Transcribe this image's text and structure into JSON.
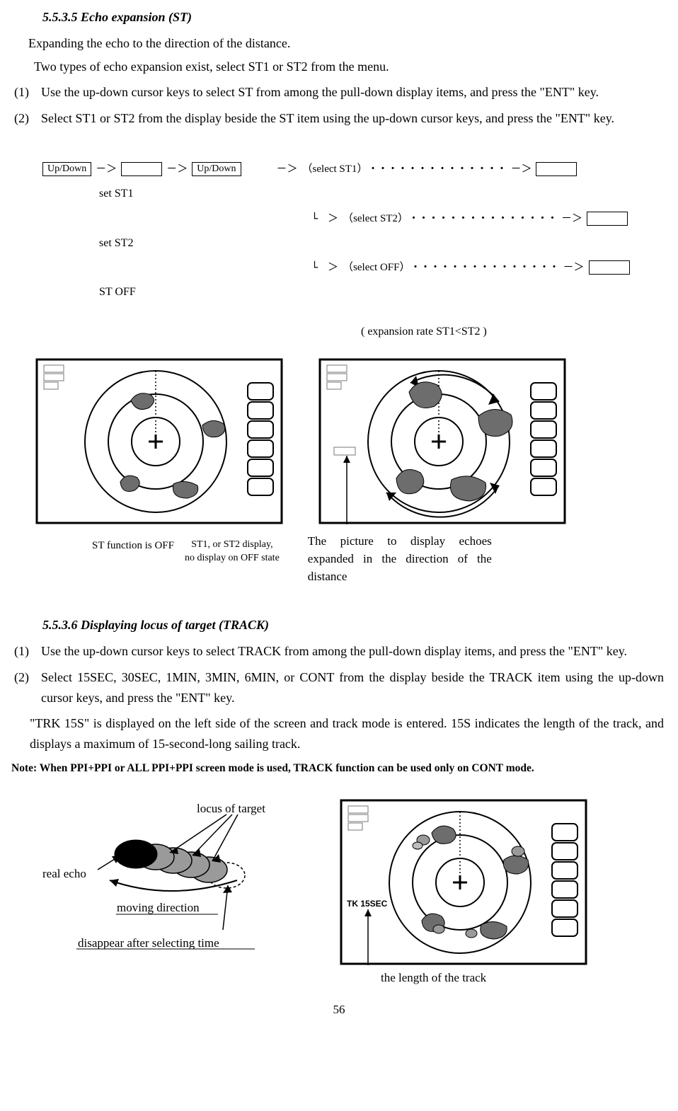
{
  "section1": {
    "heading": "5.5.3.5 Echo expansion (ST)",
    "intro1": "Expanding the echo to the direction of the distance.",
    "intro2": "Two types of echo expansion exist, select ST1 or ST2 from the menu.",
    "step1_num": "(1)",
    "step1": "Use the up-down cursor keys to select ST from among the pull-down display items, and press the \"ENT\" key.",
    "step2_num": "(2)",
    "step2": "Select ST1 or ST2 from the display beside the ST item using the up-down cursor keys, and press the \"ENT\" key."
  },
  "flow": {
    "key_updown": "Up/Down",
    "set_st1": "set ST1",
    "set_st2": "set ST2",
    "st_off": "ST OFF",
    "sel_st1": "select ST1",
    "sel_st2": "select ST2",
    "sel_off": "select OFF",
    "rate_note": "( expansion rate ST1<ST2 )"
  },
  "captions1": {
    "off": "ST function is OFF",
    "mid1": "ST1, or ST2 display,",
    "mid2": "no display on OFF state",
    "right": "The picture to display echoes expanded in the direction of the distance"
  },
  "section2": {
    "heading": "5.5.3.6 Displaying locus of target (TRACK)",
    "step1_num": "(1)",
    "step1": "Use the up-down cursor keys to select TRACK from among the pull-down display items, and press the \"ENT\" key.",
    "step2_num": "(2)",
    "step2": "Select 15SEC, 30SEC, 1MIN, 3MIN, 6MIN, or CONT from the display beside the TRACK item using the up-down cursor keys, and press the \"ENT\" key.",
    "result": "\"TRK 15S\" is displayed on the left side of the screen and track mode is entered.   15S indicates the length of the track, and displays a maximum of 15-second-long sailing track.",
    "note": "Note: When PPI+PPI or ALL PPI+PPI screen mode is used, TRACK function can be used only on CONT mode."
  },
  "locus": {
    "locus_of_target": "locus of target",
    "real_echo": "real echo",
    "moving_direction": "moving direction",
    "disappear": "disappear after selecting time",
    "tk_label": "TK 15SEC",
    "track_len": "the length of the track"
  },
  "page_number": "56"
}
